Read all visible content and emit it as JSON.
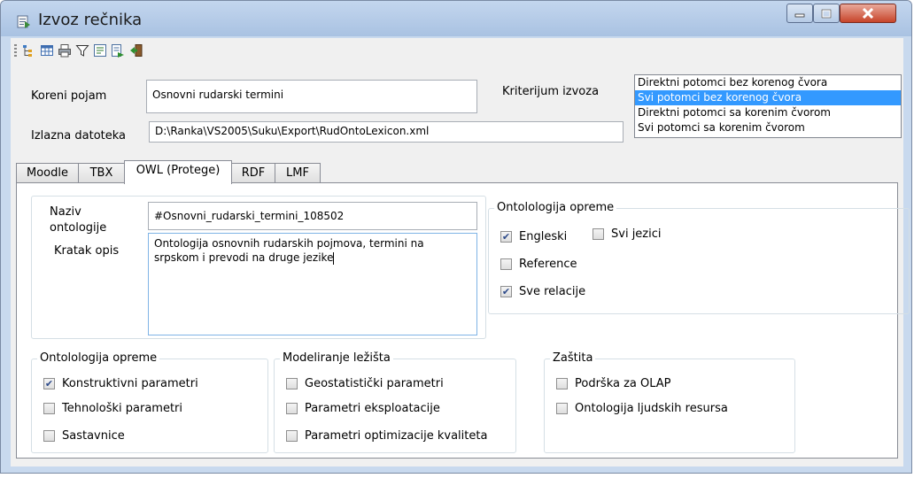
{
  "window": {
    "title": "Izvoz rečnika"
  },
  "toolbar": {
    "icons": [
      "tree-icon",
      "grid-icon",
      "print-icon",
      "filter-icon",
      "properties-icon",
      "export-icon",
      "exit-door-icon"
    ]
  },
  "form": {
    "root_label": "Koreni pojam",
    "root_value": "Osnovni rudarski termini",
    "output_label": "Izlazna datoteka",
    "output_value": "D:\\Ranka\\VS2005\\Suku\\Export\\RudOntoLexicon.xml",
    "criteria_label": "Kriterijum izvoza",
    "criteria_options": [
      "Direktni potomci bez korenog čvora",
      "Svi potomci  bez korenog čvora",
      "Direktni potomci sa korenim čvorom",
      "Svi potomci sa korenim čvorom"
    ],
    "criteria_selected_index": 1
  },
  "tabs": [
    {
      "label": "Moodle",
      "active": false
    },
    {
      "label": "TBX",
      "active": false
    },
    {
      "label": "OWL (Protege)",
      "active": true
    },
    {
      "label": "RDF",
      "active": false
    },
    {
      "label": "LMF",
      "active": false
    }
  ],
  "owl": {
    "name_label_line1": "Naziv",
    "name_label_line2": "ontologije",
    "name_value": "#Osnovni_rudarski_termini_108502",
    "desc_label": "Kratak opis",
    "desc_line1": "Ontologija osnovnih rudarskih pojmova, termini na",
    "desc_line2": "srpskom i prevodi na druge jezike",
    "equipment_group": {
      "title": "Ontolologija opreme",
      "english": {
        "label": "Engleski",
        "checked": true
      },
      "all_languages": {
        "label": "Svi jezici",
        "checked": false
      },
      "reference": {
        "label": "Reference",
        "checked": false
      },
      "all_relations": {
        "label": "Sve relacije",
        "checked": true
      }
    },
    "equipment_params_group": {
      "title": "Ontolologija opreme",
      "items": [
        {
          "label": "Konstruktivni parametri",
          "checked": true
        },
        {
          "label": "Tehnološki parametri",
          "checked": false
        },
        {
          "label": "Sastavnice",
          "checked": false
        }
      ]
    },
    "deposit_group": {
      "title": "Modeliranje ležišta",
      "items": [
        {
          "label": "Geostatistički parametri",
          "checked": false
        },
        {
          "label": "Parametri eksploatacije",
          "checked": false
        },
        {
          "label": "Parametri optimizacije kvaliteta",
          "checked": false
        }
      ]
    },
    "protection_group": {
      "title": "Zaštita",
      "items": [
        {
          "label": "Podrška za OLAP",
          "checked": false
        },
        {
          "label": "Ontologija ljudskih resursa",
          "checked": false
        }
      ]
    }
  }
}
